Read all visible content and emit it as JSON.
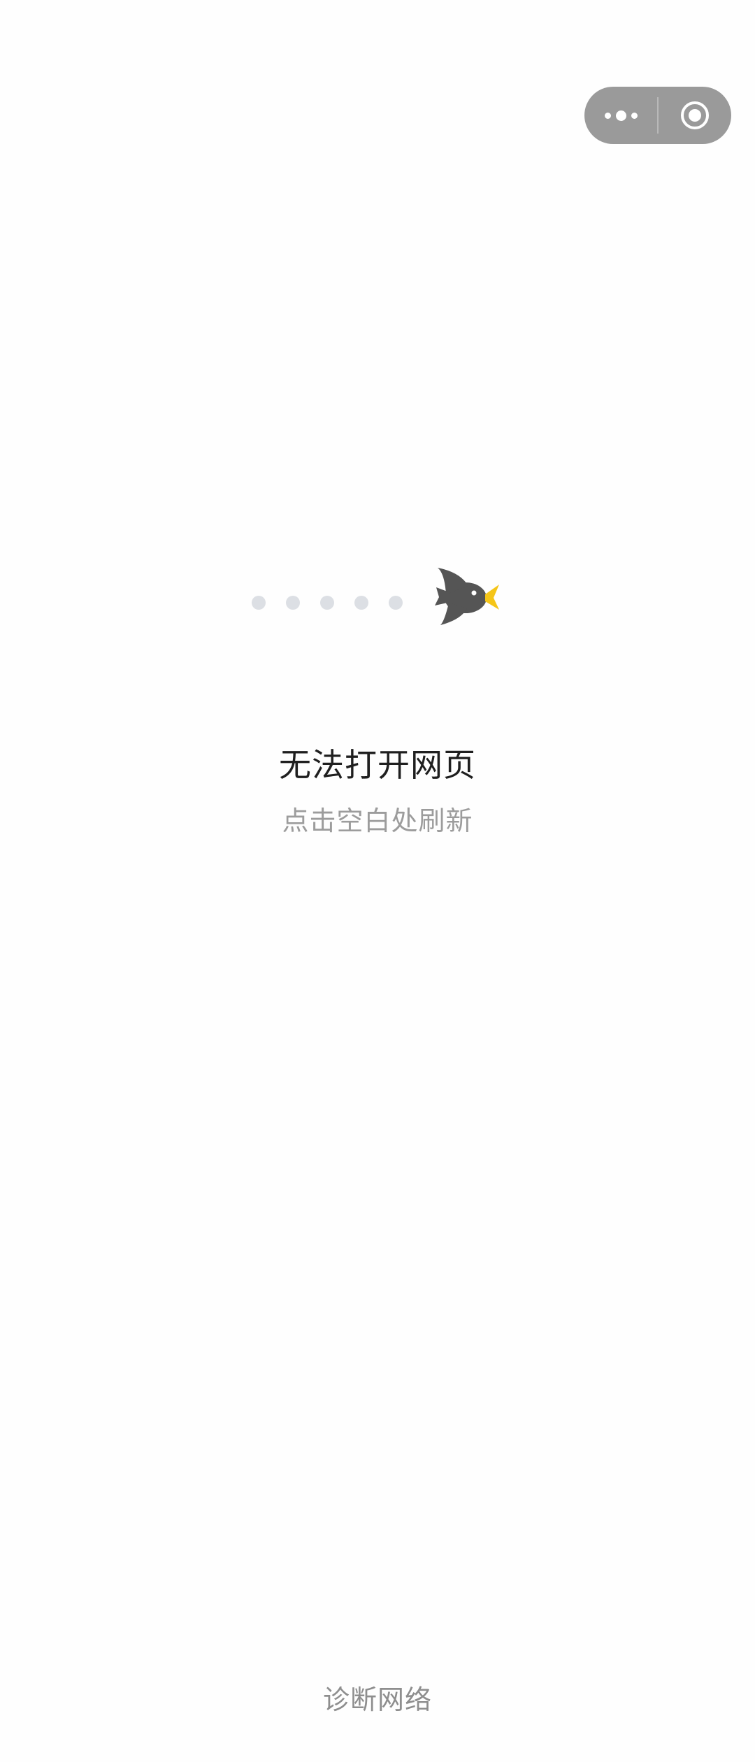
{
  "capsule": {
    "more_icon": "more-dots-icon",
    "close_icon": "target-circle-icon",
    "background": "#9a9a9a"
  },
  "illustration": {
    "trail_dots": 5,
    "bird_icon": "bird-icon",
    "bird_color": "#555555",
    "beak_color": "#f5c518"
  },
  "error": {
    "title": "无法打开网页",
    "subtitle": "点击空白处刷新"
  },
  "footer": {
    "diagnose_label": "诊断网络"
  }
}
